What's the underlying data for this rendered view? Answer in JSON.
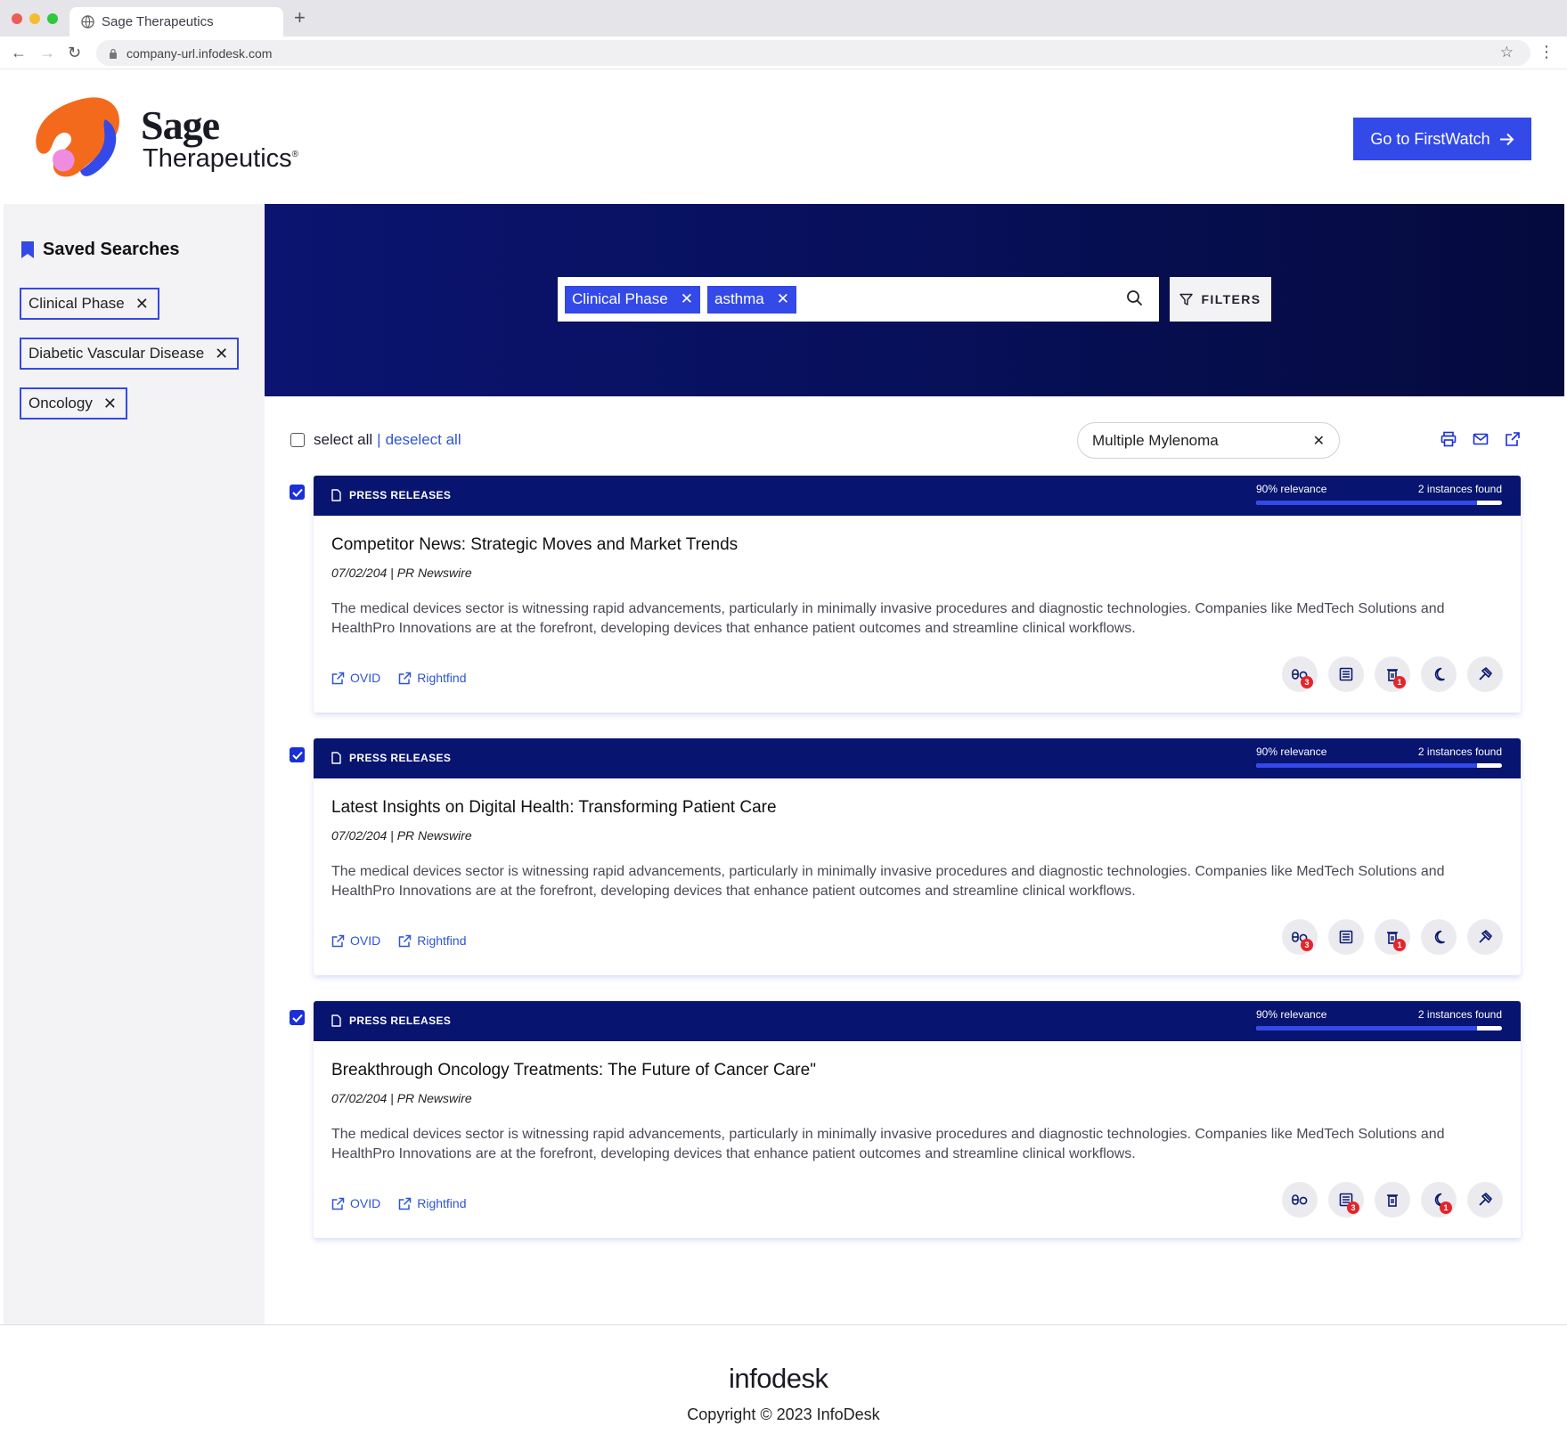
{
  "browser": {
    "tab_title": "Sage Therapeutics",
    "url": "company-url.infodesk.com"
  },
  "header": {
    "logo_word1": "Sage",
    "logo_word2": "Therapeutics",
    "logo_mark": "®",
    "cta_label": "Go to FirstWatch"
  },
  "sidebar": {
    "title": "Saved Searches",
    "items": [
      {
        "label": "Clinical Phase"
      },
      {
        "label": "Diabetic Vascular Disease"
      },
      {
        "label": "Oncology"
      }
    ]
  },
  "search": {
    "chips": [
      {
        "label": "Clinical Phase"
      },
      {
        "label": "asthma"
      }
    ],
    "filters_label": "FILTERS"
  },
  "toolbar": {
    "select_all": "select all",
    "separator": "|",
    "deselect_all": "deselect all",
    "filter_value": "Multiple Mylenoma"
  },
  "results": [
    {
      "checked": true,
      "type": "PRESS RELEASES",
      "relevance_label": "90% relevance",
      "relevance": 0.9,
      "instances": "2 instances found",
      "title": "Competitor News: Strategic Moves and Market Trends",
      "meta": "07/02/204 | PR Newswire",
      "body": "The medical devices sector is witnessing rapid advancements, particularly in minimally invasive procedures and diagnostic technologies. Companies like MedTech Solutions and HealthPro Innovations are at the forefront, developing devices that enhance patient outcomes and streamline clinical workflows.",
      "links": [
        "OVID",
        "Rightfind"
      ],
      "actions": [
        {
          "icon": "pills-icon",
          "badge": "3"
        },
        {
          "icon": "newspaper-icon",
          "badge": ""
        },
        {
          "icon": "trash-icon",
          "badge": "1"
        },
        {
          "icon": "moon-icon",
          "badge": ""
        },
        {
          "icon": "gavel-icon",
          "badge": ""
        }
      ]
    },
    {
      "checked": true,
      "type": "PRESS RELEASES",
      "relevance_label": "90% relevance",
      "relevance": 0.9,
      "instances": "2 instances found",
      "title": "Latest Insights on Digital Health: Transforming Patient Care",
      "meta": "07/02/204 | PR Newswire",
      "body": "The medical devices sector is witnessing rapid advancements, particularly in minimally invasive procedures and diagnostic technologies. Companies like MedTech Solutions and HealthPro Innovations are at the forefront, developing devices that enhance patient outcomes and streamline clinical workflows.",
      "links": [
        "OVID",
        "Rightfind"
      ],
      "actions": [
        {
          "icon": "pills-icon",
          "badge": "3"
        },
        {
          "icon": "newspaper-icon",
          "badge": ""
        },
        {
          "icon": "trash-icon",
          "badge": "1"
        },
        {
          "icon": "moon-icon",
          "badge": ""
        },
        {
          "icon": "gavel-icon",
          "badge": ""
        }
      ]
    },
    {
      "checked": true,
      "type": "PRESS RELEASES",
      "relevance_label": "90% relevance",
      "relevance": 0.9,
      "instances": "2 instances found",
      "title": "Breakthrough Oncology Treatments: The Future of Cancer Care\"",
      "meta": "07/02/204 | PR Newswire",
      "body": "The medical devices sector is witnessing rapid advancements, particularly in minimally invasive procedures and diagnostic technologies. Companies like MedTech Solutions and HealthPro Innovations are at the forefront, developing devices that enhance patient outcomes and streamline clinical workflows.",
      "links": [
        "OVID",
        "Rightfind"
      ],
      "actions": [
        {
          "icon": "pills-icon",
          "badge": ""
        },
        {
          "icon": "newspaper-icon",
          "badge": "3"
        },
        {
          "icon": "trash-icon",
          "badge": ""
        },
        {
          "icon": "moon-icon",
          "badge": "1"
        },
        {
          "icon": "gavel-icon",
          "badge": ""
        }
      ]
    }
  ],
  "footer": {
    "logo_text": "infodesk",
    "copyright": "Copyright © 2023 InfoDesk"
  },
  "colors": {
    "accent": "#3349e8",
    "card_header": "#071470",
    "hero_dark": "#050a3d",
    "badge": "#e2262c"
  }
}
